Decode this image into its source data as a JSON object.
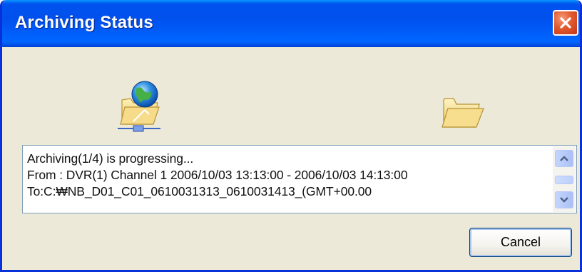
{
  "window": {
    "title": "Archiving Status"
  },
  "icons": {
    "source": "network-folder-icon",
    "destination": "folder-icon",
    "close": "close-icon"
  },
  "status": {
    "line1": "Archiving(1/4) is progressing...",
    "line2": "From : DVR(1) Channel 1 2006/10/03 13:13:00 - 2006/10/03 14:13:00",
    "line3": "To:C:₩NB_D01_C01_0610031313_0610031413_(GMT+00.00"
  },
  "buttons": {
    "cancel": "Cancel"
  },
  "colors": {
    "titlebar": "#0054e3",
    "close": "#e25a2d",
    "window_bg": "#ece9d8"
  }
}
